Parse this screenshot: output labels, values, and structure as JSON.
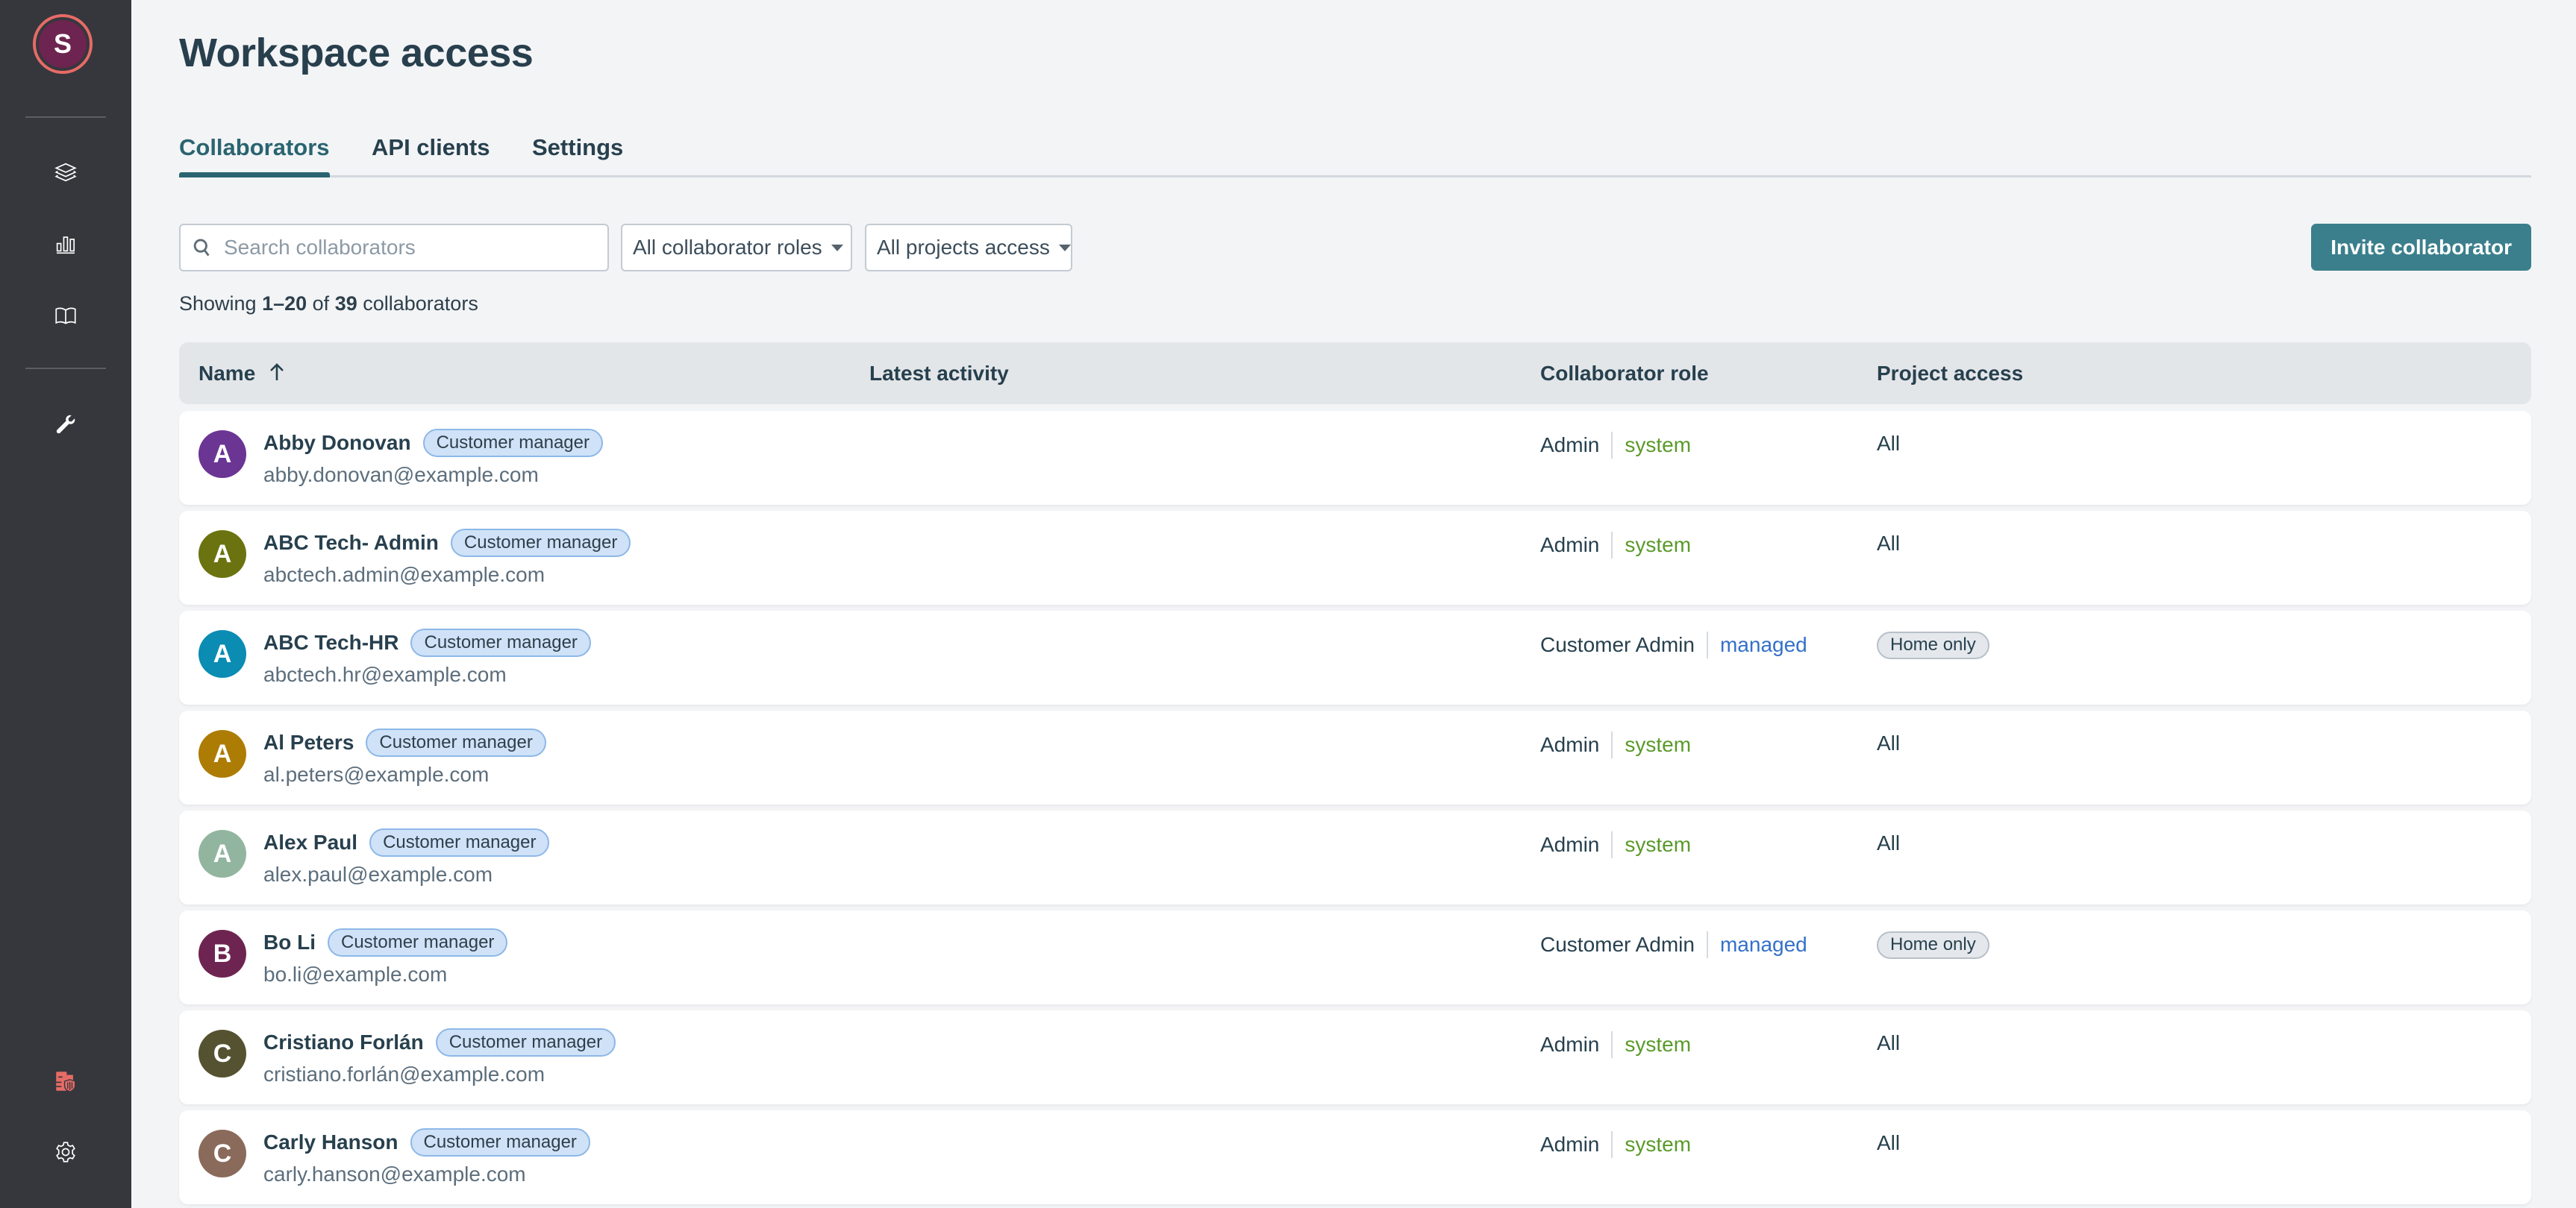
{
  "sidebar": {
    "user_initial": "S",
    "user_avatar_color": "#6e2450",
    "user_ring_color": "#e76b66",
    "items": [
      {
        "icon": "layers-icon",
        "label": "Projects"
      },
      {
        "icon": "bar-chart-icon",
        "label": "Analytics"
      },
      {
        "icon": "book-icon",
        "label": "Documentation"
      },
      {
        "icon": "wrench-icon",
        "label": "Tools"
      },
      {
        "icon": "building-shield-icon",
        "label": "Workspace access"
      },
      {
        "icon": "gear-icon",
        "label": "Settings"
      }
    ]
  },
  "header": {
    "title": "Workspace access"
  },
  "tabs": [
    {
      "label": "Collaborators",
      "active": true
    },
    {
      "label": "API clients",
      "active": false
    },
    {
      "label": "Settings",
      "active": false
    }
  ],
  "filters": {
    "search_placeholder": "Search collaborators",
    "search_value": "",
    "roles_selected": "All collaborator roles",
    "projects_selected": "All projects access"
  },
  "toolbar": {
    "invite_label": "Invite collaborator"
  },
  "summary": {
    "prefix": "Showing ",
    "range": "1–20",
    "middle": " of ",
    "total": "39",
    "suffix": " collaborators"
  },
  "table": {
    "columns": [
      "Name",
      "Latest activity",
      "Collaborator role",
      "Project access"
    ],
    "sort": {
      "column": "Name",
      "direction": "ascending"
    },
    "rows": [
      {
        "initial": "A",
        "avatar_color": "#6b3594",
        "name": "Abby Donovan",
        "badge": "Customer manager",
        "email": "abby.donovan@example.com",
        "latest_activity": "",
        "role": "Admin",
        "role_type": "system",
        "access": "All",
        "access_pill": false
      },
      {
        "initial": "A",
        "avatar_color": "#6b7310",
        "name": "ABC Tech- Admin",
        "badge": "Customer manager",
        "email": "abctech.admin@example.com",
        "latest_activity": "",
        "role": "Admin",
        "role_type": "system",
        "access": "All",
        "access_pill": false
      },
      {
        "initial": "A",
        "avatar_color": "#0a8cb3",
        "name": "ABC Tech-HR",
        "badge": "Customer manager",
        "email": "abctech.hr@example.com",
        "latest_activity": "",
        "role": "Customer Admin",
        "role_type": "managed",
        "access": "Home only",
        "access_pill": true
      },
      {
        "initial": "A",
        "avatar_color": "#ad7c05",
        "name": "Al Peters",
        "badge": "Customer manager",
        "email": "al.peters@example.com",
        "latest_activity": "",
        "role": "Admin",
        "role_type": "system",
        "access": "All",
        "access_pill": false
      },
      {
        "initial": "A",
        "avatar_color": "#92b5a0",
        "name": "Alex Paul",
        "badge": "Customer manager",
        "email": "alex.paul@example.com",
        "latest_activity": "",
        "role": "Admin",
        "role_type": "system",
        "access": "All",
        "access_pill": false
      },
      {
        "initial": "B",
        "avatar_color": "#6e2450",
        "name": "Bo Li",
        "badge": "Customer manager",
        "email": "bo.li@example.com",
        "latest_activity": "",
        "role": "Customer Admin",
        "role_type": "managed",
        "access": "Home only",
        "access_pill": true
      },
      {
        "initial": "C",
        "avatar_color": "#545230",
        "name": "Cristiano Forlán",
        "badge": "Customer manager",
        "email": "cristiano.forlán@example.com",
        "latest_activity": "",
        "role": "Admin",
        "role_type": "system",
        "access": "All",
        "access_pill": false
      },
      {
        "initial": "C",
        "avatar_color": "#8a6a5a",
        "name": "Carly Hanson",
        "badge": "Customer manager",
        "email": "carly.hanson@example.com",
        "latest_activity": "",
        "role": "Admin",
        "role_type": "system",
        "access": "All",
        "access_pill": false
      }
    ]
  },
  "colors": {
    "accent": "#3b7f8c",
    "tab_active": "#2a6470",
    "system": "#5a9a2a",
    "managed": "#3470c9",
    "badge_bg": "#cfe2f7"
  }
}
